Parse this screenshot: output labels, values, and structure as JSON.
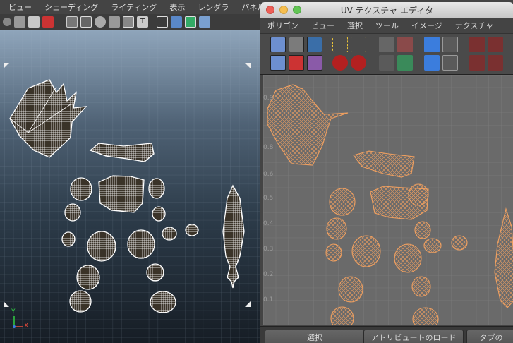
{
  "left_panel": {
    "menu": [
      "ビュー",
      "シェーディング",
      "ライティング",
      "表示",
      "レンダラ",
      "パネル"
    ],
    "shelf_icons": [
      "camera-icon",
      "bookmark-icon",
      "pencil-icon",
      "film-icon",
      "grid-icon",
      "film-gate-icon",
      "resolution-gate-icon",
      "safe-area-icon",
      "field-chart-icon",
      "texture-icon",
      "wireframe-icon",
      "shaded-icon",
      "xray-icon",
      "cube-icon"
    ],
    "axis_label_x": "X",
    "axis_label_y": "Y"
  },
  "uv_editor": {
    "title": "UV テクスチャ エディタ",
    "menu": [
      "ポリゴン",
      "ビュー",
      "選択",
      "ツール",
      "イメージ",
      "テクスチャ"
    ],
    "tick_labels": [
      "0.9",
      "0.8",
      "0.6",
      "0.5",
      "0.4",
      "0.3",
      "0.2",
      "0.1"
    ],
    "bottom_buttons": [
      "選択",
      "アトリビュートのロード",
      "タブの"
    ],
    "wire_color": "#f0a060",
    "bg_color": "#6a6a6a"
  },
  "colors": {
    "viewport_top": "#8fa5bb",
    "viewport_bottom": "#161d25",
    "mesh_white": "#ffffff"
  }
}
